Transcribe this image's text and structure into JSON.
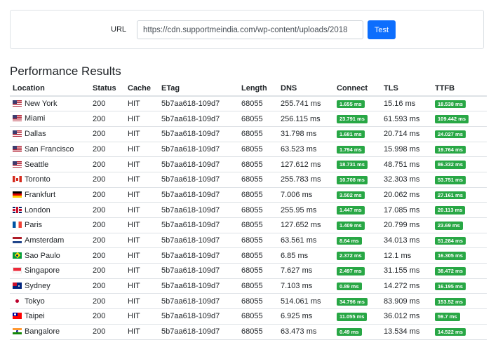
{
  "url_form": {
    "label": "URL",
    "url_value": "https://cdn.supportmeindia.com/wp-content/uploads/2018",
    "test_label": "Test"
  },
  "results": {
    "title": "Performance Results",
    "headers": [
      "Location",
      "Status",
      "Cache",
      "ETag",
      "Length",
      "DNS",
      "Connect",
      "TLS",
      "TTFB"
    ],
    "badge_color": "#28a745",
    "rows": [
      {
        "flag": "us-flag-icon",
        "location": "New York",
        "status": "200",
        "cache": "HIT",
        "etag": "5b7aa618-109d7",
        "length": "68055",
        "dns": "255.741 ms",
        "connect": "1.655 ms",
        "tls": "15.16 ms",
        "ttfb": "18.538 ms"
      },
      {
        "flag": "us-flag-icon",
        "location": "Miami",
        "status": "200",
        "cache": "HIT",
        "etag": "5b7aa618-109d7",
        "length": "68055",
        "dns": "256.115 ms",
        "connect": "23.791 ms",
        "tls": "61.593 ms",
        "ttfb": "109.442 ms"
      },
      {
        "flag": "us-flag-icon",
        "location": "Dallas",
        "status": "200",
        "cache": "HIT",
        "etag": "5b7aa618-109d7",
        "length": "68055",
        "dns": "31.798 ms",
        "connect": "1.681 ms",
        "tls": "20.714 ms",
        "ttfb": "24.027 ms"
      },
      {
        "flag": "us-flag-icon",
        "location": "San Francisco",
        "status": "200",
        "cache": "HIT",
        "etag": "5b7aa618-109d7",
        "length": "68055",
        "dns": "63.523 ms",
        "connect": "1.794 ms",
        "tls": "15.998 ms",
        "ttfb": "19.764 ms"
      },
      {
        "flag": "us-flag-icon",
        "location": "Seattle",
        "status": "200",
        "cache": "HIT",
        "etag": "5b7aa618-109d7",
        "length": "68055",
        "dns": "127.612 ms",
        "connect": "18.731 ms",
        "tls": "48.751 ms",
        "ttfb": "86.332 ms"
      },
      {
        "flag": "ca-flag-icon",
        "location": "Toronto",
        "status": "200",
        "cache": "HIT",
        "etag": "5b7aa618-109d7",
        "length": "68055",
        "dns": "255.783 ms",
        "connect": "10.708 ms",
        "tls": "32.303 ms",
        "ttfb": "53.751 ms"
      },
      {
        "flag": "de-flag-icon",
        "location": "Frankfurt",
        "status": "200",
        "cache": "HIT",
        "etag": "5b7aa618-109d7",
        "length": "68055",
        "dns": "7.006 ms",
        "connect": "3.502 ms",
        "tls": "20.062 ms",
        "ttfb": "27.161 ms"
      },
      {
        "flag": "gb-flag-icon",
        "location": "London",
        "status": "200",
        "cache": "HIT",
        "etag": "5b7aa618-109d7",
        "length": "68055",
        "dns": "255.95 ms",
        "connect": "1.447 ms",
        "tls": "17.085 ms",
        "ttfb": "20.113 ms"
      },
      {
        "flag": "fr-flag-icon",
        "location": "Paris",
        "status": "200",
        "cache": "HIT",
        "etag": "5b7aa618-109d7",
        "length": "68055",
        "dns": "127.652 ms",
        "connect": "1.409 ms",
        "tls": "20.799 ms",
        "ttfb": "23.69 ms"
      },
      {
        "flag": "nl-flag-icon",
        "location": "Amsterdam",
        "status": "200",
        "cache": "HIT",
        "etag": "5b7aa618-109d7",
        "length": "68055",
        "dns": "63.561 ms",
        "connect": "8.64 ms",
        "tls": "34.013 ms",
        "ttfb": "51.284 ms"
      },
      {
        "flag": "br-flag-icon",
        "location": "Sao Paulo",
        "status": "200",
        "cache": "HIT",
        "etag": "5b7aa618-109d7",
        "length": "68055",
        "dns": "6.85 ms",
        "connect": "2.372 ms",
        "tls": "12.1 ms",
        "ttfb": "16.305 ms"
      },
      {
        "flag": "sg-flag-icon",
        "location": "Singapore",
        "status": "200",
        "cache": "HIT",
        "etag": "5b7aa618-109d7",
        "length": "68055",
        "dns": "7.627 ms",
        "connect": "2.497 ms",
        "tls": "31.155 ms",
        "ttfb": "38.472 ms"
      },
      {
        "flag": "au-flag-icon",
        "location": "Sydney",
        "status": "200",
        "cache": "HIT",
        "etag": "5b7aa618-109d7",
        "length": "68055",
        "dns": "7.103 ms",
        "connect": "0.89 ms",
        "tls": "14.272 ms",
        "ttfb": "16.195 ms"
      },
      {
        "flag": "jp-flag-icon",
        "location": "Tokyo",
        "status": "200",
        "cache": "HIT",
        "etag": "5b7aa618-109d7",
        "length": "68055",
        "dns": "514.061 ms",
        "connect": "34.796 ms",
        "tls": "83.909 ms",
        "ttfb": "153.52 ms"
      },
      {
        "flag": "tw-flag-icon",
        "location": "Taipei",
        "status": "200",
        "cache": "HIT",
        "etag": "5b7aa618-109d7",
        "length": "68055",
        "dns": "6.925 ms",
        "connect": "11.055 ms",
        "tls": "36.012 ms",
        "ttfb": "59.7 ms"
      },
      {
        "flag": "in-flag-icon",
        "location": "Bangalore",
        "status": "200",
        "cache": "HIT",
        "etag": "5b7aa618-109d7",
        "length": "68055",
        "dns": "63.473 ms",
        "connect": "0.49 ms",
        "tls": "13.534 ms",
        "ttfb": "14.522 ms"
      }
    ]
  }
}
